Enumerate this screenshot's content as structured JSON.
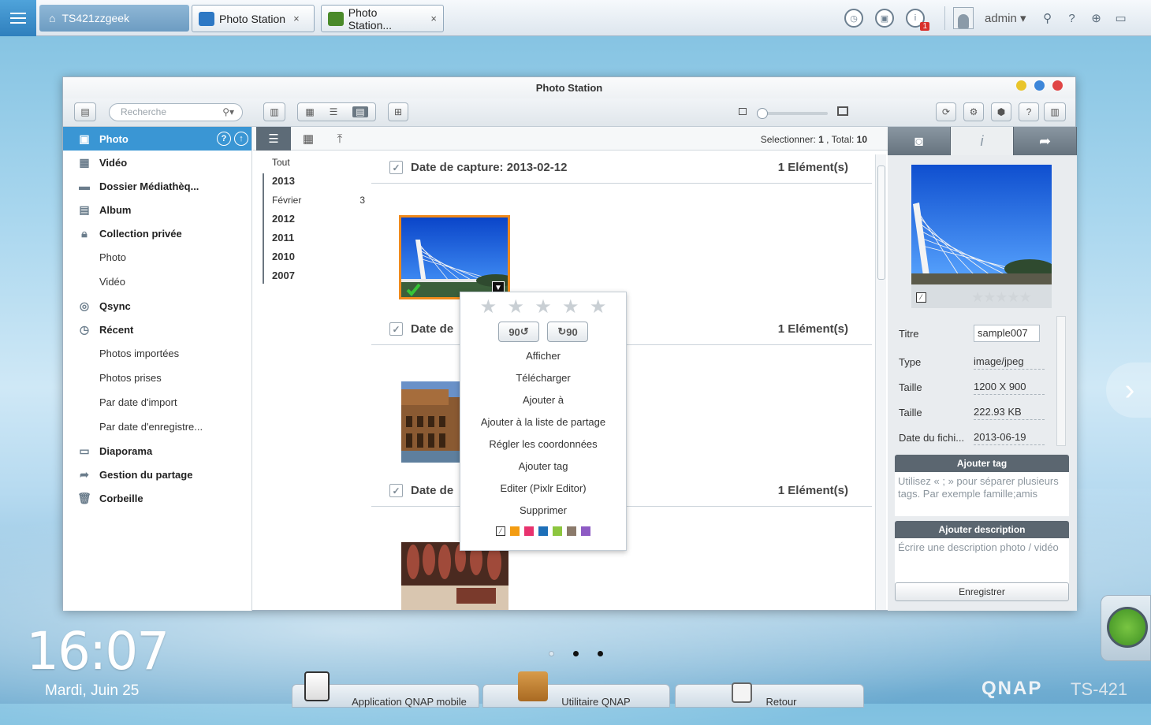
{
  "topbar": {
    "nas_name": "TS421zzgeek",
    "tabs": [
      {
        "label": "Photo Station",
        "close": "×"
      },
      {
        "label": "Photo Station...",
        "close": "×"
      }
    ],
    "notification_count": "1",
    "user": "admin"
  },
  "window": {
    "title": "Photo Station",
    "search_placeholder": "Recherche"
  },
  "sidebar": {
    "items": [
      {
        "label": "Photo",
        "icon": "photo-icon",
        "active": true
      },
      {
        "label": "Vidéo",
        "icon": "video-icon"
      },
      {
        "label": "Dossier Médiathèq...",
        "icon": "folder-icon"
      },
      {
        "label": "Album",
        "icon": "album-icon"
      },
      {
        "label": "Collection privée",
        "icon": "lock-icon"
      },
      {
        "label": "Photo",
        "sub": true
      },
      {
        "label": "Vidéo",
        "sub": true
      },
      {
        "label": "Qsync",
        "icon": "qsync-icon"
      },
      {
        "label": "Récent",
        "icon": "clock-icon"
      },
      {
        "label": "Photos importées",
        "sub": true
      },
      {
        "label": "Photos prises",
        "sub": true
      },
      {
        "label": "Par date d'import",
        "sub": true
      },
      {
        "label": "Par date d'enregistre...",
        "sub": true
      },
      {
        "label": "Diaporama",
        "icon": "slideshow-icon"
      },
      {
        "label": "Gestion du partage",
        "icon": "share-icon"
      },
      {
        "label": "Corbeille",
        "icon": "trash-icon"
      }
    ]
  },
  "main": {
    "selection_label": "Selectionner:",
    "selection_count": "1",
    "total_label": ", Total:",
    "total_count": "10",
    "timeline": {
      "all": "Tout",
      "entries": [
        {
          "type": "year",
          "label": "2013"
        },
        {
          "type": "month",
          "label": "Février",
          "count": "3"
        },
        {
          "type": "year",
          "label": "2012"
        },
        {
          "type": "year",
          "label": "2011"
        },
        {
          "type": "year",
          "label": "2010"
        },
        {
          "type": "year",
          "label": "2007"
        }
      ]
    },
    "groups": [
      {
        "title": "Date de capture: 2013-02-12",
        "count": "1 Elément(s)"
      },
      {
        "title": "Date de",
        "count": "1 Elément(s)"
      },
      {
        "title": "Date de",
        "count": "1 Elément(s)"
      }
    ]
  },
  "context_menu": {
    "rotate_left": "90",
    "rotate_right": "90",
    "items": [
      "Afficher",
      "Télécharger",
      "Ajouter à",
      "Ajouter à la liste de partage",
      "Régler les coordonnées",
      "Ajouter tag",
      "Editer (Pixlr Editor)",
      "Supprimer"
    ],
    "colors": [
      "#f39c12",
      "#e8326e",
      "#1d6fb8",
      "#8dc63f",
      "#8b7a6b",
      "#8e5bc4"
    ]
  },
  "info_panel": {
    "fields": [
      {
        "label": "Type",
        "value": "image/jpeg"
      },
      {
        "label": "Taille",
        "value": "1200 X 900"
      },
      {
        "label": "Taille",
        "value": "222.93 KB"
      },
      {
        "label": "Date du fichi...",
        "value": "2013-06-19"
      }
    ],
    "title_label": "Titre",
    "title_value": "sample007",
    "tag_header": "Ajouter tag",
    "tag_hint": "Utilisez « ; » pour séparer plusieurs tags. Par exemple famille;amis",
    "desc_header": "Ajouter description",
    "desc_hint": "Écrire une description photo / vidéo",
    "save_label": "Enregistrer"
  },
  "desktop": {
    "time": "16:07",
    "date": "Mardi, Juin 25",
    "dock": [
      {
        "label": "Application QNAP mobile"
      },
      {
        "label": "Utilitaire QNAP"
      },
      {
        "label": "Retour"
      }
    ],
    "brand": "QNAP",
    "model": "TS-421"
  }
}
